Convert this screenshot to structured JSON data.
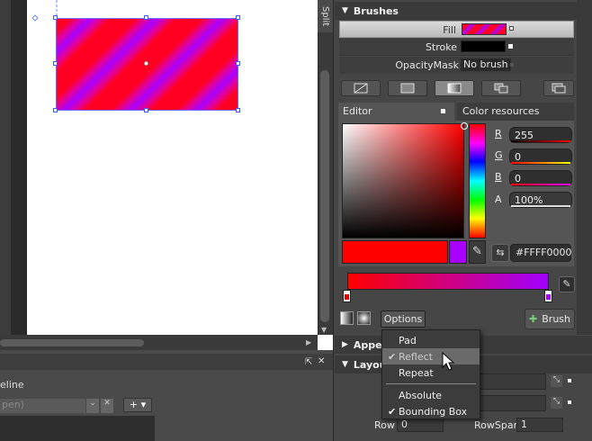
{
  "canvas": {
    "split_label": "Split"
  },
  "timeline": {
    "label": "eline",
    "open_text": "pen)"
  },
  "brushes": {
    "title": "Brushes",
    "fill_label": "Fill",
    "stroke_label": "Stroke",
    "opacity_label": "OpacityMask",
    "opacity_value": "No brush",
    "tabs": [
      "Editor",
      "Color resources"
    ],
    "channels": [
      {
        "label": "R",
        "value": "255"
      },
      {
        "label": "G",
        "value": "0"
      },
      {
        "label": "B",
        "value": "0"
      },
      {
        "label": "A",
        "value": "100%"
      }
    ],
    "hex": "#FFFF0000",
    "options_label": "Options",
    "brush_button": "Brush",
    "gradient_stops": [
      "#ff0000",
      "#a000ff"
    ]
  },
  "options_menu": {
    "items": [
      {
        "label": "Pad",
        "checked": false
      },
      {
        "label": "Reflect",
        "checked": true
      },
      {
        "label": "Repeat",
        "checked": false
      },
      {
        "label": "Absolute",
        "checked": false
      },
      {
        "label": "Bounding Box",
        "checked": true
      }
    ]
  },
  "appearance": {
    "title": "Appea"
  },
  "layout": {
    "title": "Layou",
    "row_label": "Row",
    "row_value": "0",
    "rowspan_label": "RowSpan",
    "rowspan_value": "1"
  },
  "colors": {
    "accent": "#ff0000",
    "purple": "#a800ff",
    "panel": "#464646"
  }
}
